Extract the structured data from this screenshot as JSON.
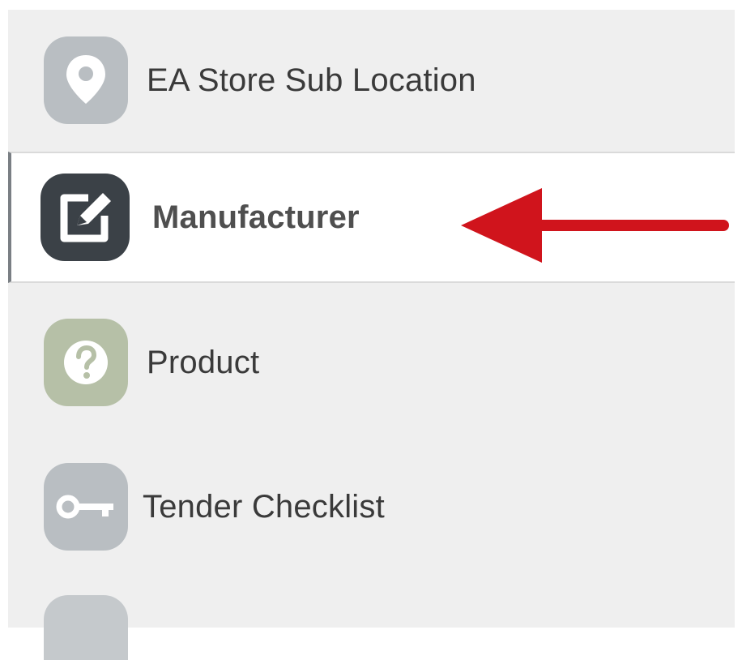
{
  "sidebar": {
    "items": [
      {
        "label": "EA Store Sub Location",
        "icon": "map-pin-icon",
        "active": false
      },
      {
        "label": "Manufacturer",
        "icon": "edit-icon",
        "active": true
      },
      {
        "label": "Product",
        "icon": "question-icon",
        "active": false
      },
      {
        "label": "Tender Checklist",
        "icon": "key-icon",
        "active": false
      }
    ]
  },
  "colors": {
    "panel_background": "#efefef",
    "active_background": "#ffffff",
    "active_icon": "#3b4147",
    "inactive_icon": "#b9bec2",
    "question_icon": "#b6c0a7",
    "arrow": "#d0141c"
  },
  "annotation": {
    "type": "arrow",
    "points_to": "Manufacturer"
  }
}
